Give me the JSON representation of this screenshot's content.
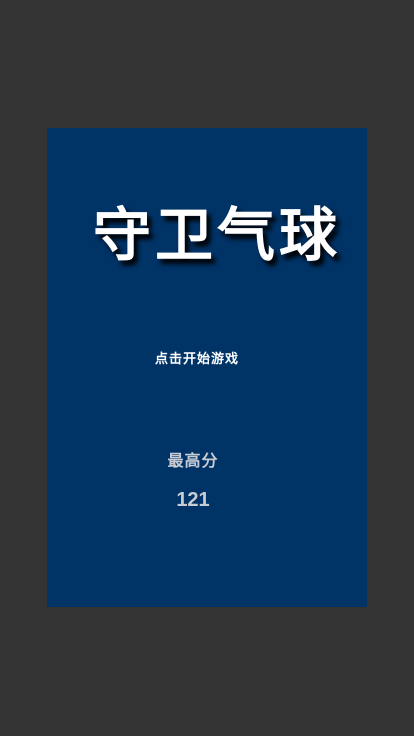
{
  "game": {
    "title": "守卫气球",
    "start_label": "点击开始游戏",
    "high_score_label": "最高分",
    "high_score_value": "121"
  },
  "colors": {
    "page_background": "#333333",
    "panel_background": "#003366",
    "title_text": "#ffffff",
    "score_text": "#c8ccd4"
  }
}
